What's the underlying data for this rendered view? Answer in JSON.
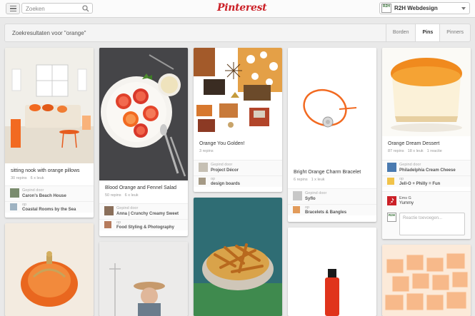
{
  "header": {
    "search_placeholder": "Zoeken",
    "logo": "Pinterest",
    "account_name": "R2H Webdesign",
    "account_avatar": "R2H"
  },
  "results": {
    "title": "Zoekresultaten voor \"orange\"",
    "tabs": [
      "Borden",
      "Pins",
      "Pinners"
    ],
    "active_tab": "Pins"
  },
  "pins": [
    {
      "desc": "sitting nook with orange pillows",
      "repins": "30 repins",
      "likes": "6 x leuk",
      "pinned_by_label": "Gepind door",
      "pinned_by": "Caron's Beach House",
      "onto_label": "op",
      "onto": "Coastal Rooms by the Sea"
    },
    {
      "desc": "Blood Orange and Fennel Salad",
      "repins": "50 repins",
      "likes": "6 x leuk",
      "pinned_by_label": "Gepind door",
      "pinned_by": "Anna | Crunchy Creamy Sweet",
      "onto_label": "op",
      "onto": "Food Styling & Photography"
    },
    {
      "desc": "Orange You Golden!",
      "repins": "3 repins",
      "pinned_by_label": "Gepind door",
      "pinned_by": "Project Décor",
      "onto_label": "op",
      "onto": "design boards"
    },
    {
      "desc": "Bright Orange Charm Bracelet",
      "repins": "6 repins",
      "likes": "1 x leuk",
      "pinned_by_label": "Gepind door",
      "pinned_by": "Syflo",
      "onto_label": "op",
      "onto": "Bracelets & Bangles"
    },
    {
      "desc": "Orange Dream Dessert",
      "repins": "87 repins",
      "likes": "18 x leuk",
      "comments": "1 reactie",
      "pinned_by_label": "Gepind door",
      "pinned_by": "Philadelphia Cream Cheese",
      "onto_label": "op",
      "onto": "Jell-O + Philly = Fun",
      "commenter": "Ems G",
      "comment": "Yummy",
      "my_avatar": "R2H",
      "comment_placeholder": "Reactie toevoegen..."
    }
  ],
  "colors": {
    "brand": "#cb2027",
    "orange": "#f26a21",
    "background": "#e9e9e9"
  }
}
